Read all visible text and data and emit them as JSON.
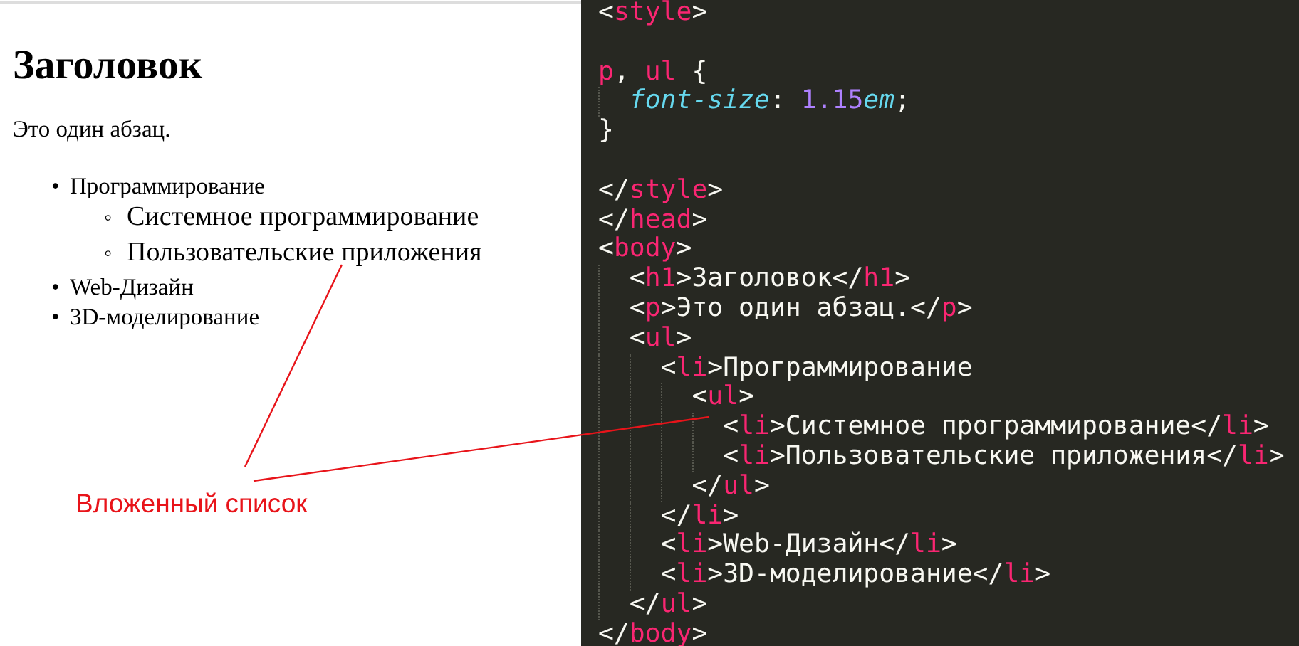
{
  "preview": {
    "heading": "Заголовок",
    "paragraph": "Это один абзац.",
    "list": [
      {
        "marker": "•",
        "text": "Программирование",
        "children": [
          {
            "marker": "◦",
            "text": "Системное программирование"
          },
          {
            "marker": "◦",
            "text": "Пользовательские приложения"
          }
        ]
      },
      {
        "marker": "•",
        "text": "Web-Дизайн"
      },
      {
        "marker": "•",
        "text": "3D-моделирование"
      }
    ]
  },
  "annotation": {
    "label": "Вложенный список"
  },
  "code": {
    "lines": [
      {
        "kind": "code",
        "tokens": [
          {
            "kind": "punct",
            "text": "<"
          },
          {
            "kind": "tag",
            "text": "style"
          },
          {
            "kind": "punct",
            "text": ">"
          }
        ]
      },
      {
        "kind": "blank"
      },
      {
        "kind": "code",
        "tokens": [
          {
            "kind": "tag",
            "text": "p"
          },
          {
            "kind": "punct",
            "text": ", "
          },
          {
            "kind": "tag",
            "text": "ul"
          },
          {
            "kind": "punct",
            "text": " {"
          }
        ]
      },
      {
        "kind": "code",
        "tokens": [
          {
            "kind": "property",
            "text": "  font-size"
          },
          {
            "kind": "punct",
            "text": ": "
          },
          {
            "kind": "number",
            "text": "1.15"
          },
          {
            "kind": "property",
            "text": "em"
          },
          {
            "kind": "punct",
            "text": ";"
          }
        ]
      },
      {
        "kind": "code",
        "tokens": [
          {
            "kind": "punct",
            "text": "}"
          }
        ]
      },
      {
        "kind": "blank"
      },
      {
        "kind": "code",
        "tokens": [
          {
            "kind": "punct",
            "text": "</"
          },
          {
            "kind": "tag",
            "text": "style"
          },
          {
            "kind": "punct",
            "text": ">"
          }
        ]
      },
      {
        "kind": "code",
        "tokens": [
          {
            "kind": "punct",
            "text": "</"
          },
          {
            "kind": "tag",
            "text": "head"
          },
          {
            "kind": "punct",
            "text": ">"
          }
        ]
      },
      {
        "kind": "code",
        "tokens": [
          {
            "kind": "punct",
            "text": "<"
          },
          {
            "kind": "tag",
            "text": "body"
          },
          {
            "kind": "punct",
            "text": ">"
          }
        ]
      },
      {
        "kind": "code",
        "tokens": [
          {
            "kind": "punct",
            "text": "  <"
          },
          {
            "kind": "tag",
            "text": "h1"
          },
          {
            "kind": "punct",
            "text": ">Заголовок</"
          },
          {
            "kind": "tag",
            "text": "h1"
          },
          {
            "kind": "punct",
            "text": ">"
          }
        ]
      },
      {
        "kind": "code",
        "tokens": [
          {
            "kind": "punct",
            "text": "  <"
          },
          {
            "kind": "tag",
            "text": "p"
          },
          {
            "kind": "punct",
            "text": ">Это один абзац.</"
          },
          {
            "kind": "tag",
            "text": "p"
          },
          {
            "kind": "punct",
            "text": ">"
          }
        ]
      },
      {
        "kind": "code",
        "tokens": [
          {
            "kind": "punct",
            "text": "  <"
          },
          {
            "kind": "tag",
            "text": "ul"
          },
          {
            "kind": "punct",
            "text": ">"
          }
        ]
      },
      {
        "kind": "code",
        "tokens": [
          {
            "kind": "punct",
            "text": "    <"
          },
          {
            "kind": "tag",
            "text": "li"
          },
          {
            "kind": "punct",
            "text": ">Программирование"
          }
        ]
      },
      {
        "kind": "code",
        "tokens": [
          {
            "kind": "punct",
            "text": "      <"
          },
          {
            "kind": "tag",
            "text": "ul"
          },
          {
            "kind": "punct",
            "text": ">"
          }
        ]
      },
      {
        "kind": "code",
        "tokens": [
          {
            "kind": "punct",
            "text": "        <"
          },
          {
            "kind": "tag",
            "text": "li"
          },
          {
            "kind": "punct",
            "text": ">Системное программирование</"
          },
          {
            "kind": "tag",
            "text": "li"
          },
          {
            "kind": "punct",
            "text": ">"
          }
        ]
      },
      {
        "kind": "code",
        "tokens": [
          {
            "kind": "punct",
            "text": "        <"
          },
          {
            "kind": "tag",
            "text": "li"
          },
          {
            "kind": "punct",
            "text": ">Пользовательские приложения</"
          },
          {
            "kind": "tag",
            "text": "li"
          },
          {
            "kind": "punct",
            "text": ">"
          }
        ]
      },
      {
        "kind": "code",
        "tokens": [
          {
            "kind": "punct",
            "text": "      </"
          },
          {
            "kind": "tag",
            "text": "ul"
          },
          {
            "kind": "punct",
            "text": ">"
          }
        ]
      },
      {
        "kind": "code",
        "tokens": [
          {
            "kind": "punct",
            "text": "    </"
          },
          {
            "kind": "tag",
            "text": "li"
          },
          {
            "kind": "punct",
            "text": ">"
          }
        ]
      },
      {
        "kind": "code",
        "tokens": [
          {
            "kind": "punct",
            "text": "    <"
          },
          {
            "kind": "tag",
            "text": "li"
          },
          {
            "kind": "punct",
            "text": ">Web-Дизайн</"
          },
          {
            "kind": "tag",
            "text": "li"
          },
          {
            "kind": "punct",
            "text": ">"
          }
        ]
      },
      {
        "kind": "code",
        "tokens": [
          {
            "kind": "punct",
            "text": "    <"
          },
          {
            "kind": "tag",
            "text": "li"
          },
          {
            "kind": "punct",
            "text": ">3D-моделирование</"
          },
          {
            "kind": "tag",
            "text": "li"
          },
          {
            "kind": "punct",
            "text": ">"
          }
        ]
      },
      {
        "kind": "code",
        "tokens": [
          {
            "kind": "punct",
            "text": "  </"
          },
          {
            "kind": "tag",
            "text": "ul"
          },
          {
            "kind": "punct",
            "text": ">"
          }
        ]
      },
      {
        "kind": "code",
        "tokens": [
          {
            "kind": "punct",
            "text": "</"
          },
          {
            "kind": "tag",
            "text": "body"
          },
          {
            "kind": "punct",
            "text": ">"
          }
        ]
      }
    ]
  }
}
